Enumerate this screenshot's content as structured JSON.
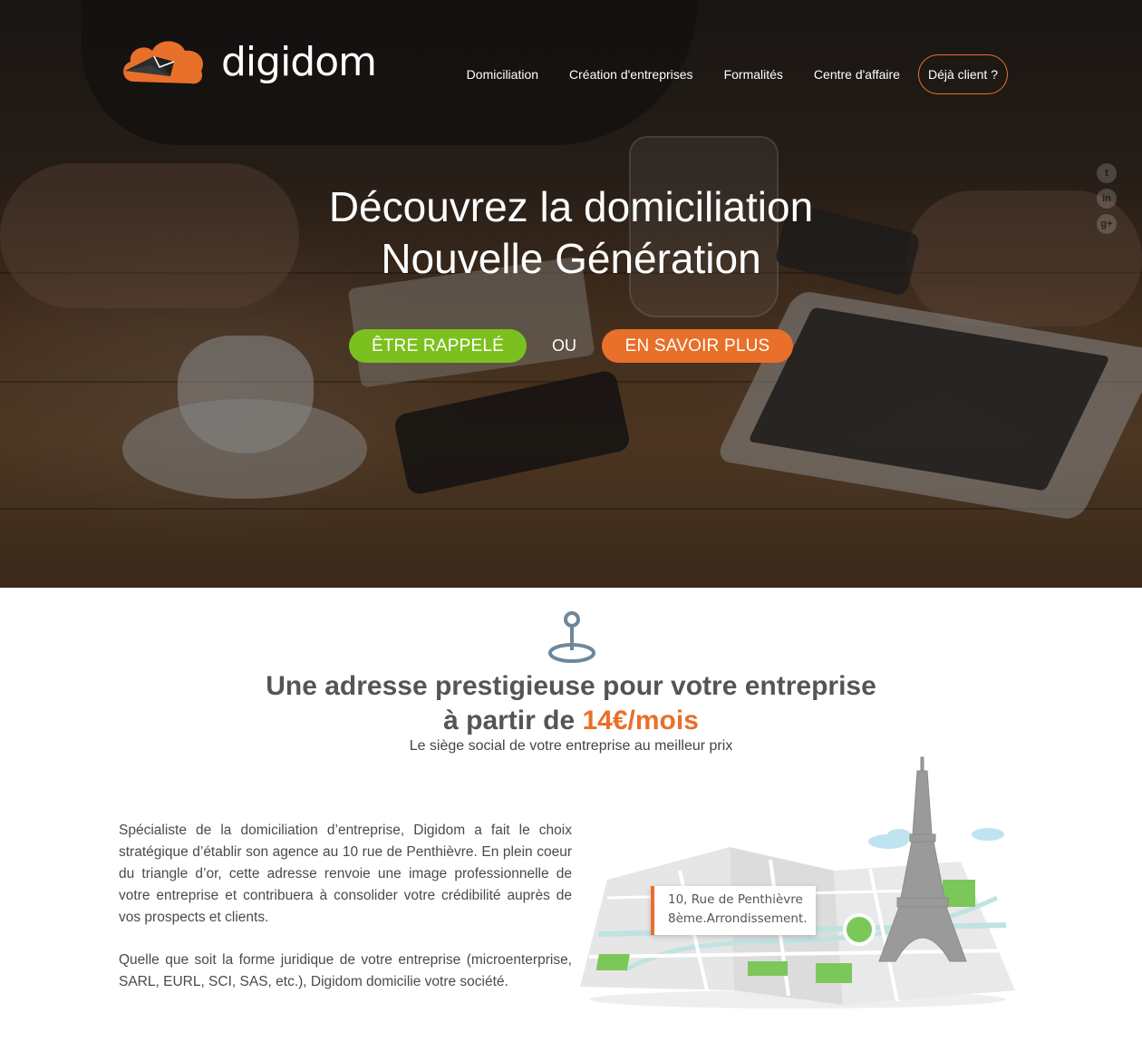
{
  "brand": {
    "name": "digidom",
    "accent": "#e8702a",
    "cta_green": "#7cc01f"
  },
  "nav": {
    "items": [
      "Domiciliation",
      "Création d'entreprises",
      "Formalités",
      "Centre d'affaire"
    ],
    "client_button": "Déjà client ?"
  },
  "social": {
    "icons": [
      "twitter-icon",
      "linkedin-icon",
      "google-plus-icon"
    ],
    "labels": [
      "t",
      "in",
      "g+"
    ]
  },
  "hero": {
    "title_line1": "Découvrez la domiciliation",
    "title_line2": "Nouvelle Génération",
    "cta_callback": "ÊTRE RAPPELÉ",
    "cta_or": "OU",
    "cta_more": "EN SAVOIR PLUS"
  },
  "address_section": {
    "icon": "map-pin-icon",
    "title_line1": "Une adresse prestigieuse pour votre entreprise",
    "title_line2_prefix": "à partir de ",
    "price": "14€/mois",
    "subtitle": "Le siège social de votre entreprise au meilleur prix",
    "paragraph1": "Spécialiste de la domiciliation d’entreprise, Digidom a fait le choix stratégique d’établir son agence au 10 rue de Penthièvre. En plein coeur du triangle d’or, cette adresse renvoie une image professionnelle de votre entreprise et contribuera à consolider votre crédibilité auprès de vos prospects et clients.",
    "paragraph2": "Quelle que soit la forme juridique de votre entreprise (microenterprise, SARL, EURL, SCI, SAS, etc.), Digidom domicilie votre société.",
    "map_card_line1": "10, Rue de Penthièvre",
    "map_card_line2": "8ème.Arrondissement."
  }
}
